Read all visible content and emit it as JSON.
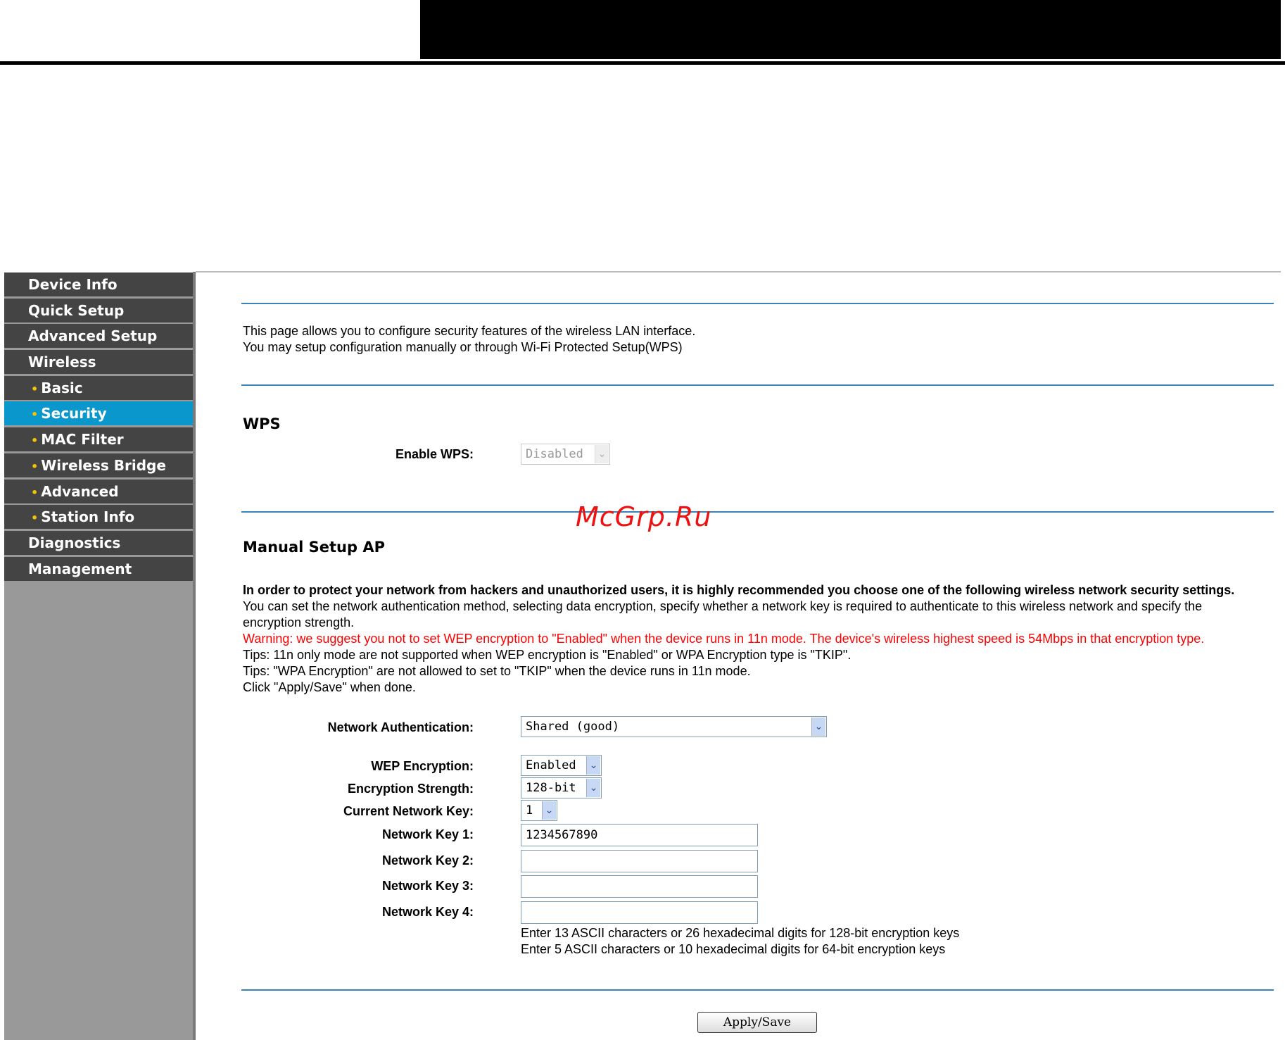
{
  "sidebar": {
    "items": [
      {
        "label": "Device Info"
      },
      {
        "label": "Quick Setup"
      },
      {
        "label": "Advanced Setup"
      },
      {
        "label": "Wireless"
      },
      {
        "label": "Basic"
      },
      {
        "label": "Security"
      },
      {
        "label": "MAC Filter"
      },
      {
        "label": "Wireless Bridge"
      },
      {
        "label": "Advanced"
      },
      {
        "label": "Station Info"
      },
      {
        "label": "Diagnostics"
      },
      {
        "label": "Management"
      }
    ],
    "active_color": "#0a98cc",
    "bullet_color": "#f5c400"
  },
  "intro": {
    "line1": "This page allows you to configure security features of the wireless LAN interface.",
    "line2": "You may setup configuration manually or through Wi-Fi Protected Setup(WPS)"
  },
  "wps": {
    "heading": "WPS",
    "enable_label": "Enable WPS:",
    "enable_value": "Disabled"
  },
  "watermark": "McGrp.Ru",
  "manual": {
    "heading": "Manual Setup AP",
    "bold_note": "In order to protect your network from hackers and unauthorized users, it is highly recommended you choose one of the following wireless network security settings.",
    "desc1": "You can set the network authentication method, selecting data encryption, specify whether a network key is required to authenticate to this wireless network and specify the",
    "desc2": "encryption strength.",
    "warning": "Warning: we suggest you not to set WEP encryption to \"Enabled\" when the device runs in 11n mode. The device's wireless highest speed is 54Mbps in that encryption type.",
    "tip1": "Tips: 11n only mode are not supported when WEP encryption is \"Enabled\" or WPA Encryption type is \"TKIP\".",
    "tip2": "Tips: \"WPA Encryption\" are not allowed to set to \"TKIP\" when the device runs in 11n mode.",
    "click": "Click \"Apply/Save\" when done."
  },
  "form": {
    "auth_label": "Network Authentication:",
    "auth_value": "Shared (good)",
    "wep_label": "WEP Encryption:",
    "wep_value": "Enabled",
    "strength_label": "Encryption Strength:",
    "strength_value": "128-bit",
    "current_key_label": "Current Network Key:",
    "current_key_value": "1",
    "key1_label": "Network Key 1:",
    "key1_value": "1234567890",
    "key2_label": "Network Key 2:",
    "key2_value": "",
    "key3_label": "Network Key 3:",
    "key3_value": "",
    "key4_label": "Network Key 4:",
    "key4_value": "",
    "hint1": "Enter 13 ASCII characters or 26 hexadecimal digits for 128-bit encryption keys",
    "hint2": "Enter 5 ASCII characters or 10 hexadecimal digits for 64-bit encryption keys"
  },
  "apply_label": "Apply/Save"
}
